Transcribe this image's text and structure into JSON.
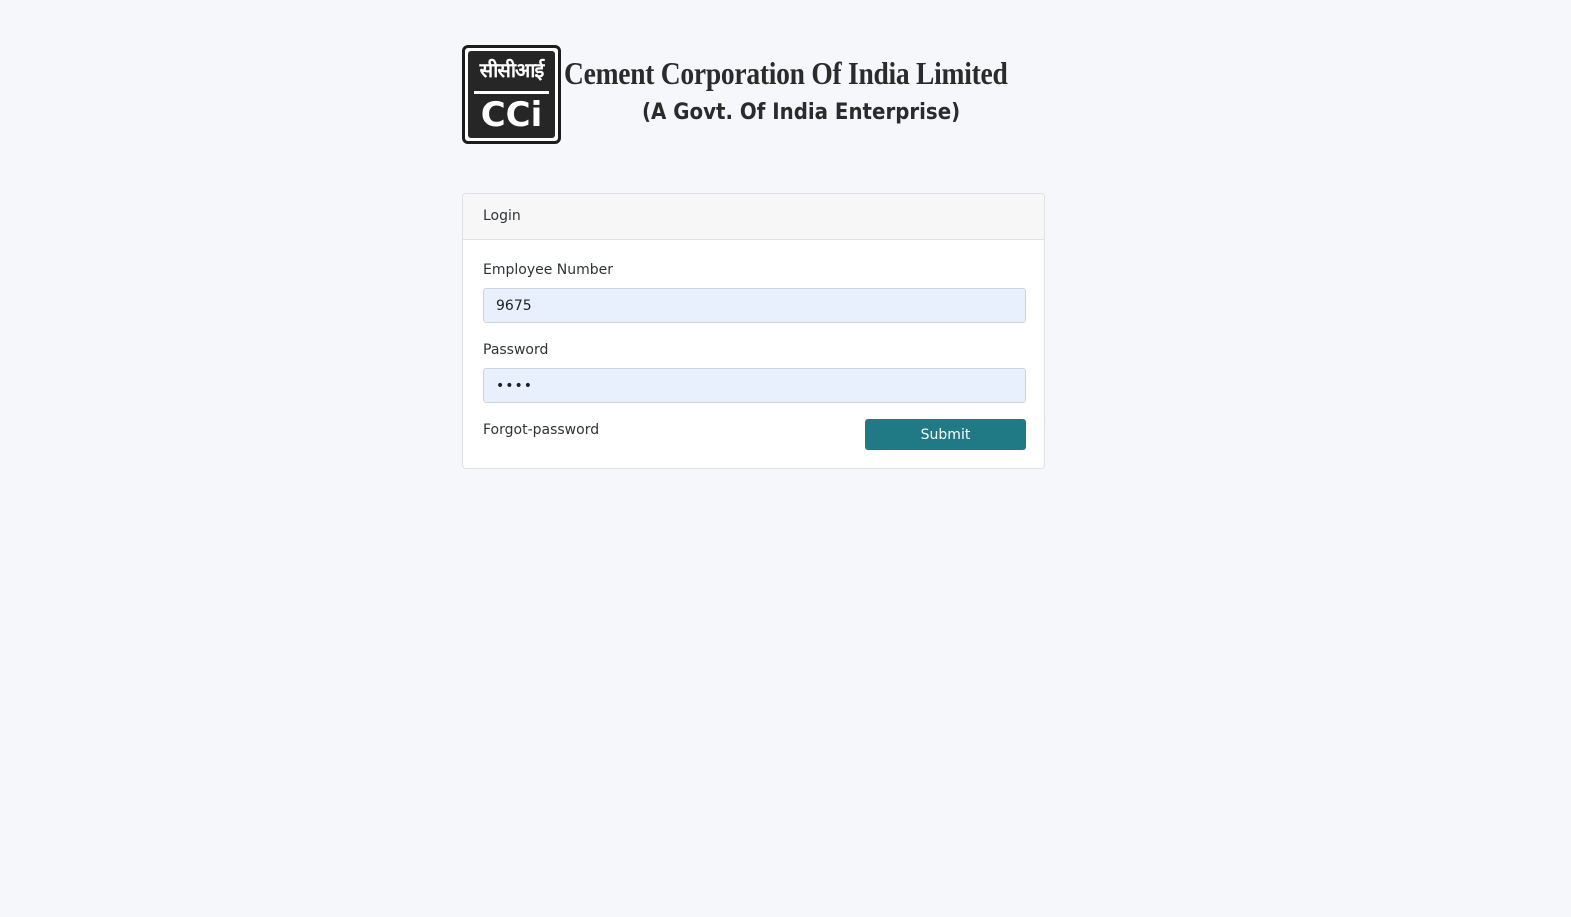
{
  "logo": {
    "emblem_hindi": "सीसीआई",
    "emblem_abbr": "CCi",
    "title": "Cement Corporation Of India Limited",
    "subtitle": "(A Govt. Of India Enterprise)"
  },
  "login_card": {
    "header": "Login",
    "employee_number": {
      "label": "Employee Number",
      "value": "9675"
    },
    "password": {
      "label": "Password",
      "value": "••••"
    },
    "forgot_password_label": "Forgot-password",
    "submit_label": "Submit"
  },
  "colors": {
    "page_background": "#f5f7fa",
    "input_background": "#e8f0fe",
    "submit_button": "#1f7a85"
  }
}
